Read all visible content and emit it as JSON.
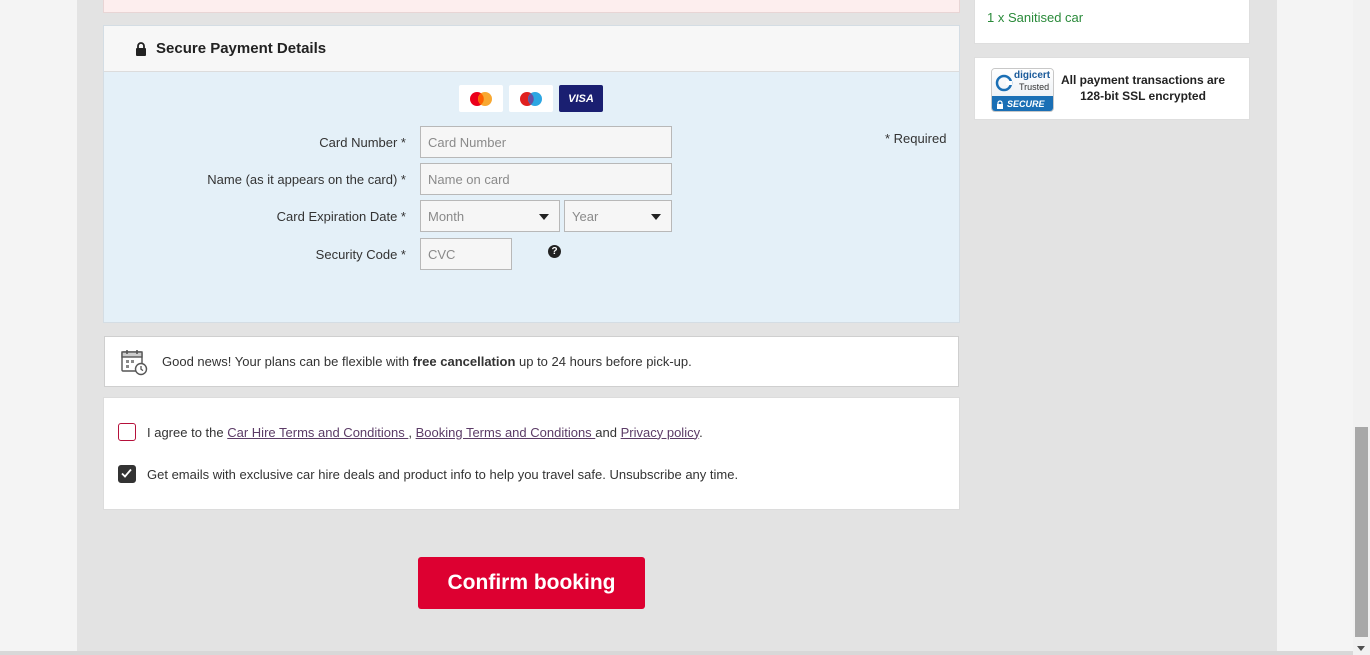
{
  "payment": {
    "title": "Secure Payment Details",
    "required_note": "* Required",
    "card_logos": {
      "visa": "VISA"
    },
    "fields": {
      "card_number": {
        "label": "Card Number *",
        "placeholder": "Card Number"
      },
      "name": {
        "label": "Name (as it appears on the card) *",
        "placeholder": "Name on card"
      },
      "expiration": {
        "label": "Card Expiration Date *",
        "month": "Month",
        "year": "Year"
      },
      "security": {
        "label": "Security Code *",
        "placeholder": "CVC"
      }
    }
  },
  "cancellation": {
    "prefix": "Good news! Your plans can be flexible with ",
    "bold": "free cancellation",
    "suffix": " up to 24 hours before pick-up."
  },
  "terms": {
    "agree_prefix": "I agree to the ",
    "car_hire_terms": "Car Hire Terms and Conditions ",
    "sep": ", ",
    "booking_terms": "Booking Terms and Conditions ",
    "and": "and ",
    "privacy": "Privacy policy",
    "period": ".",
    "agree_checked": false,
    "emails_label": "Get emails with exclusive car hire deals and product info to help you travel safe. Unsubscribe any time.",
    "emails_checked": true
  },
  "confirm_button": "Confirm booking",
  "sidebar": {
    "feature_item": "1 x Sanitised car",
    "digicert_brand": "digicert",
    "digicert_trusted": "Trusted",
    "digicert_secure": "SECURE",
    "ssl_text_line1": "All payment transactions are",
    "ssl_text_line2": "128-bit SSL encrypted"
  },
  "colors": {
    "confirm": "#dd0031",
    "link": "#5b3b66",
    "feature_green": "#2a8a3a",
    "payment_bg": "#e4f0f8"
  }
}
